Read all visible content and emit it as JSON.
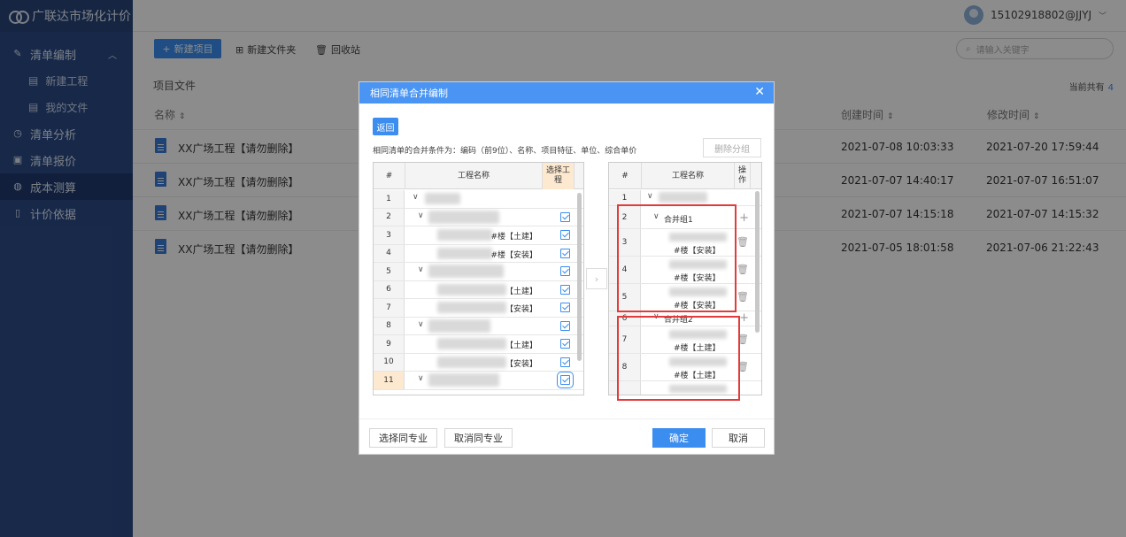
{
  "app": {
    "title": "广联达市场化计价"
  },
  "sidebar": {
    "items": [
      {
        "label": "清单编制",
        "icon": "edit-icon"
      },
      {
        "label": "新建工程",
        "icon": "new-doc-icon"
      },
      {
        "label": "我的文件",
        "icon": "file-icon"
      },
      {
        "label": "清单分析",
        "icon": "clock-icon"
      },
      {
        "label": "清单报价",
        "icon": "list-icon"
      },
      {
        "label": "成本测算",
        "icon": "palette-icon"
      },
      {
        "label": "计价依据",
        "icon": "book-icon"
      }
    ]
  },
  "header": {
    "user": "15102918802@JJYJ"
  },
  "toolbar": {
    "new_project": "新建项目",
    "new_folder": "新建文件夹",
    "recycle_bin": "回收站",
    "search_placeholder": "请输入关键字"
  },
  "main": {
    "section_label": "项目文件",
    "count_label": "当前共有",
    "count_value": "4",
    "columns": {
      "name": "名称",
      "created": "创建时间",
      "modified": "修改时间"
    },
    "rows": [
      {
        "name": "XX广场工程【请勿删除】",
        "created": "2021-07-08 10:03:33",
        "modified": "2021-07-20 17:59:44"
      },
      {
        "name": "XX广场工程【请勿删除】",
        "created": "2021-07-07 14:40:17",
        "modified": "2021-07-07 16:51:07"
      },
      {
        "name": "XX广场工程【请勿删除】",
        "created": "2021-07-07 14:15:18",
        "modified": "2021-07-07 14:15:32"
      },
      {
        "name": "XX广场工程【请勿删除】",
        "created": "2021-07-05 18:01:58",
        "modified": "2021-07-06 21:22:43"
      }
    ]
  },
  "modal": {
    "title": "相同清单合并编制",
    "back": "返回",
    "condition": "相同清单的合并条件为：编码（前9位）、名称、项目特征、单位、综合单价",
    "delete_group": "删除分组",
    "left_grid": {
      "col_num": "#",
      "col_name": "工程名称",
      "col_select": "选择工程",
      "rows": [
        {
          "num": "1",
          "tag": ""
        },
        {
          "num": "2",
          "tag": ""
        },
        {
          "num": "3",
          "tag": "#楼【土建】"
        },
        {
          "num": "4",
          "tag": "#楼【安装】"
        },
        {
          "num": "5",
          "tag": ""
        },
        {
          "num": "6",
          "tag": "【土建】"
        },
        {
          "num": "7",
          "tag": "【安装】"
        },
        {
          "num": "8",
          "tag": ""
        },
        {
          "num": "9",
          "tag": "【土建】"
        },
        {
          "num": "10",
          "tag": "【安装】"
        },
        {
          "num": "11",
          "tag": ""
        }
      ]
    },
    "right_grid": {
      "col_num": "#",
      "col_name": "工程名称",
      "col_action": "操作",
      "rows": [
        {
          "num": "1",
          "title": "",
          "sub": ""
        },
        {
          "num": "2",
          "title": "合并组1",
          "sub": ""
        },
        {
          "num": "3",
          "title": "",
          "sub": "#楼【安装】"
        },
        {
          "num": "4",
          "title": "",
          "sub": "#楼【安装】"
        },
        {
          "num": "5",
          "title": "",
          "sub": "#楼【安装】"
        },
        {
          "num": "6",
          "title": "合并组2",
          "sub": ""
        },
        {
          "num": "7",
          "title": "",
          "sub": "#楼【土建】"
        },
        {
          "num": "8",
          "title": "",
          "sub": "#楼【土建】"
        }
      ]
    },
    "footer": {
      "select_same": "选择同专业",
      "cancel_same": "取消同专业",
      "ok": "确定",
      "cancel": "取消"
    }
  }
}
